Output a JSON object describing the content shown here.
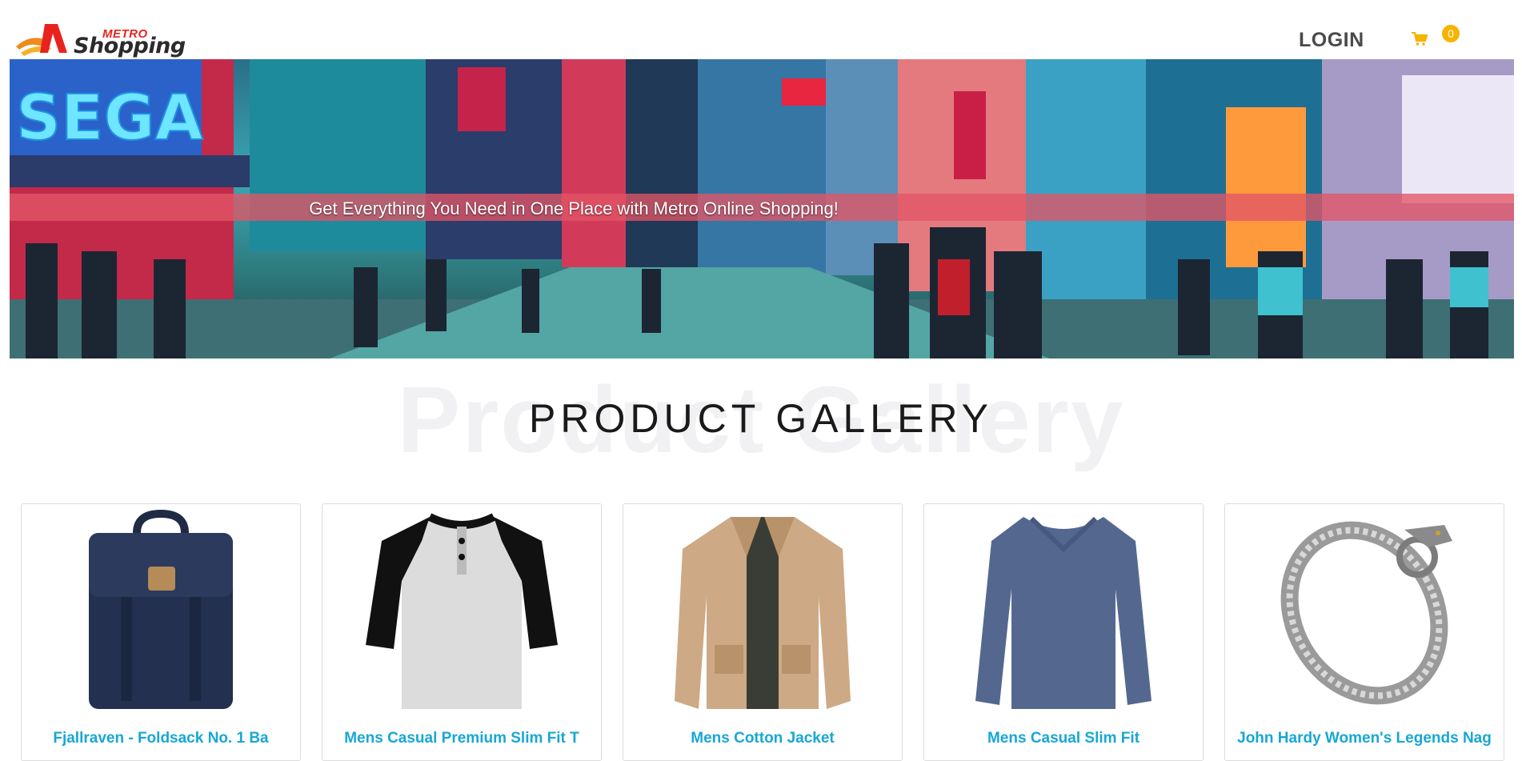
{
  "brand": {
    "logo_metro": "METRO",
    "logo_shopping": "Shopping"
  },
  "nav": {
    "login_label": "LOGIN",
    "cart_count": "0"
  },
  "banner": {
    "tagline": "Get Everything You Need in One Place with Metro Online Shopping!"
  },
  "gallery": {
    "ghost_text": "Product Gallery",
    "title": "PRODUCT GALLERY"
  },
  "products": [
    {
      "title": "Fjallraven - Foldsack No. 1 Ba",
      "image": "backpack-image"
    },
    {
      "title": "Mens Casual Premium Slim Fit T",
      "image": "raglan-tshirt-image"
    },
    {
      "title": "Mens Cotton Jacket",
      "image": "jacket-image"
    },
    {
      "title": "Mens Casual Slim Fit",
      "image": "longsleeve-image"
    },
    {
      "title": "John Hardy Women's Legends Nag",
      "image": "bracelet-image"
    }
  ]
}
